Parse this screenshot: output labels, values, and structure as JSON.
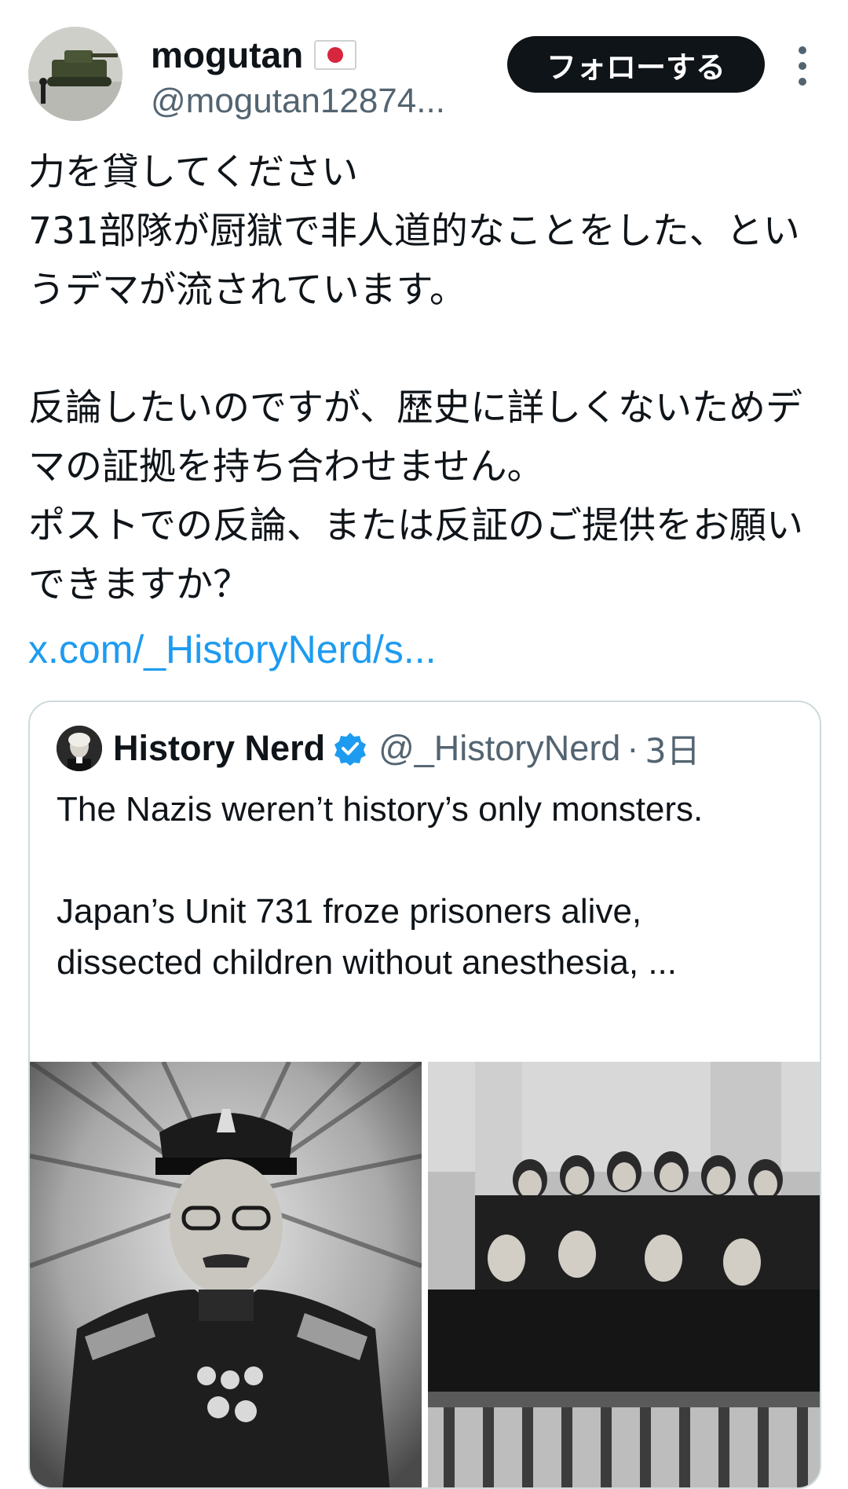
{
  "author": {
    "display_name": "mogutan",
    "handle": "@mogutan12874...",
    "flag_icon": "japan-flag-icon",
    "avatar_icon": "tank-photo-avatar"
  },
  "actions": {
    "follow_label": "フォローする",
    "more_icon": "more-vertical-icon"
  },
  "post": {
    "text": "力を貸してください\n731部隊が厨獄で非人道的なことをした、というデマが流されています。\n\n反論したいのですが、歴史に詳しくないためデマの証拠を持ち合わせません。\nポストでの反論、または反証のご提供をお願いできますか？",
    "link": "x.com/_HistoryNerd/s..."
  },
  "quote": {
    "display_name": "History Nerd",
    "verified_icon": "verified-badge-icon",
    "handle": "@_HistoryNerd",
    "separator": "·",
    "time": "3日",
    "text": "The Nazis weren’t history’s only monsters.\n\nJapan’s Unit 731 froze prisoners alive, dissected children without anesthesia, ...",
    "media": [
      {
        "icon": "officer-portrait-photo"
      },
      {
        "icon": "courtroom-photo"
      }
    ]
  },
  "colors": {
    "link": "#1d9bf0",
    "secondary_text": "#536471",
    "primary_text": "#0f1419",
    "border": "#cfd9de",
    "verified": "#1d9bf0"
  }
}
